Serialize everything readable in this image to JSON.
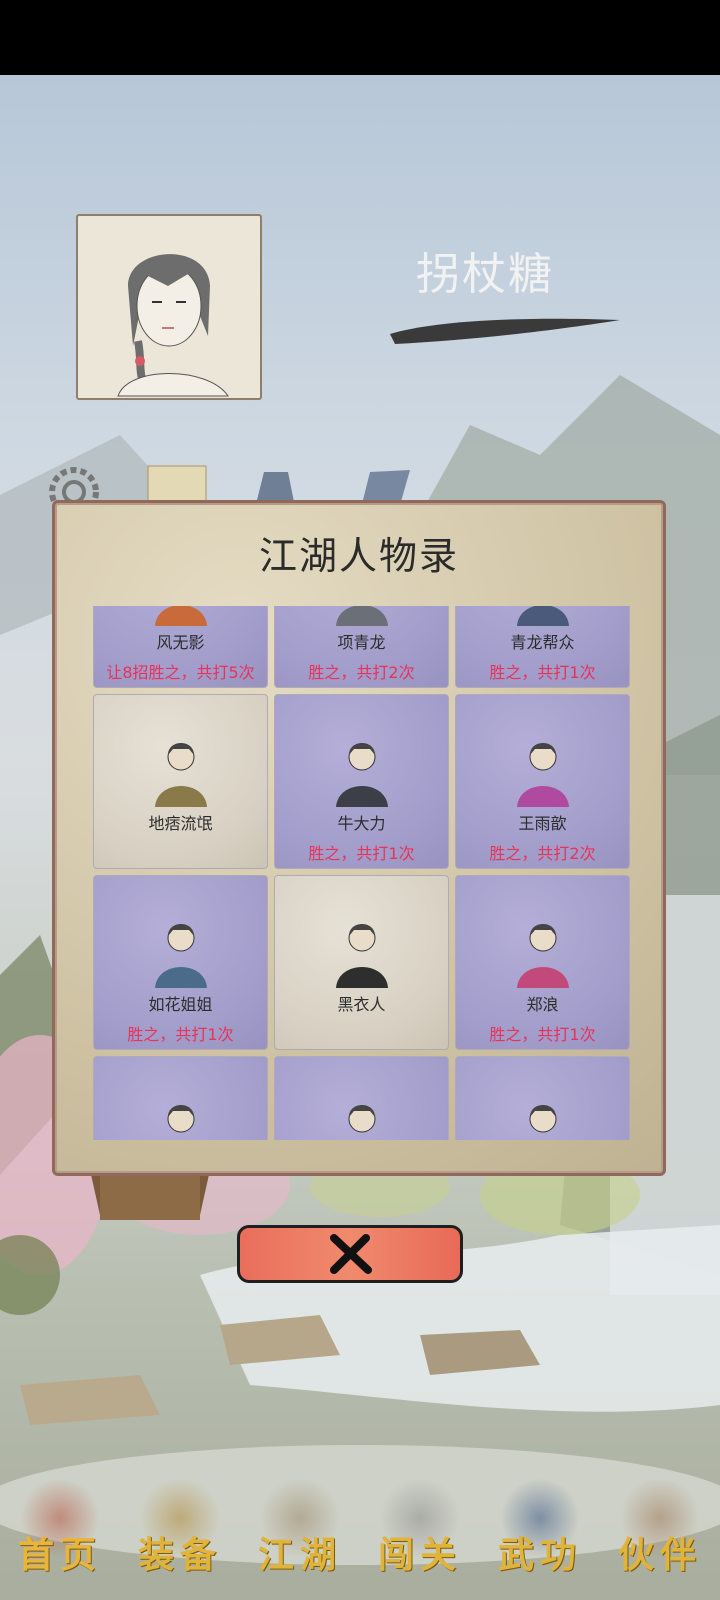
{
  "player": {
    "name": "拐杖糖"
  },
  "dialog": {
    "title": "江湖人物录",
    "characters": [
      {
        "name": "风无影",
        "record": "让8招胜之，共打5次",
        "style": "purple"
      },
      {
        "name": "项青龙",
        "record": "胜之，共打2次",
        "style": "purple"
      },
      {
        "name": "青龙帮众",
        "record": "胜之，共打1次",
        "style": "purple"
      },
      {
        "name": "地痞流氓",
        "record": "",
        "style": "beige"
      },
      {
        "name": "牛大力",
        "record": "胜之，共打1次",
        "style": "purple"
      },
      {
        "name": "王雨歆",
        "record": "胜之，共打2次",
        "style": "purple"
      },
      {
        "name": "如花姐姐",
        "record": "胜之，共打1次",
        "style": "purple"
      },
      {
        "name": "黑衣人",
        "record": "",
        "style": "beige"
      },
      {
        "name": "郑浪",
        "record": "胜之，共打1次",
        "style": "purple"
      },
      {
        "name": "",
        "record": "",
        "style": "purple"
      },
      {
        "name": "",
        "record": "",
        "style": "purple"
      },
      {
        "name": "",
        "record": "",
        "style": "purple"
      }
    ]
  },
  "nav": {
    "items": [
      {
        "label": "首页",
        "icon": "home-house-icon",
        "active": true
      },
      {
        "label": "装备",
        "icon": "armor-icon"
      },
      {
        "label": "江湖",
        "icon": "map-scroll-icon"
      },
      {
        "label": "闯关",
        "icon": "crossed-swords-icon"
      },
      {
        "label": "武功",
        "icon": "martial-book-icon"
      },
      {
        "label": "伙伴",
        "icon": "companions-icon"
      }
    ]
  },
  "colors": {
    "record_red": "#e8325a",
    "nav_gold": "#e0b33a",
    "card_purple": "#a19cc9",
    "card_beige": "#d7d0c2",
    "close_red": "#ec7a62"
  }
}
